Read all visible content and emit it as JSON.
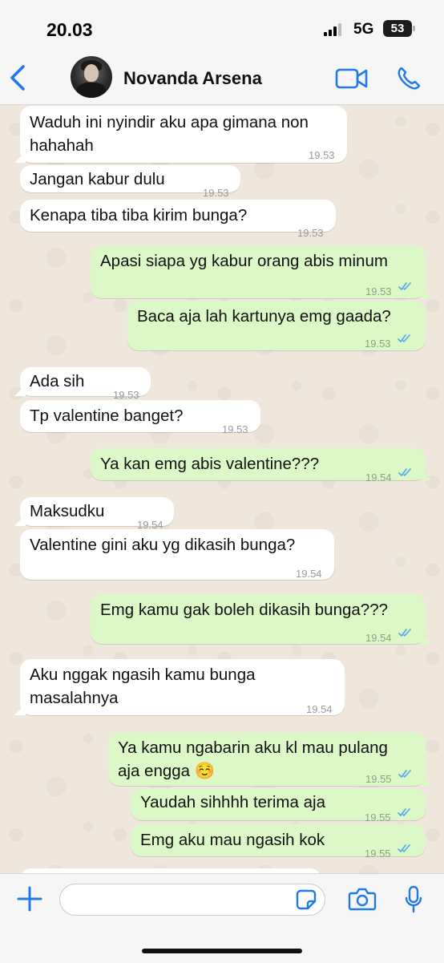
{
  "status_bar": {
    "time": "20.03",
    "network": "5G",
    "battery": "53"
  },
  "header": {
    "contact_name": "Novanda Arsena"
  },
  "messages": [
    {
      "dir": "in",
      "lines": [
        "Waduh ini nyindir aku apa gimana non",
        "hahahah"
      ],
      "time": "19.53"
    },
    {
      "dir": "in",
      "lines": [
        "Jangan kabur dulu"
      ],
      "time": "19.53"
    },
    {
      "dir": "in",
      "lines": [
        "Kenapa tiba tiba kirim bunga?"
      ],
      "time": "19.53"
    },
    {
      "dir": "out",
      "lines": [
        "Apasi siapa yg kabur orang abis minum"
      ],
      "time": "19.53",
      "read": true
    },
    {
      "dir": "out",
      "lines": [
        "Baca aja lah kartunya emg gaada?"
      ],
      "time": "19.53",
      "read": true
    },
    {
      "dir": "in",
      "lines": [
        "Ada sih"
      ],
      "time": "19.53"
    },
    {
      "dir": "in",
      "lines": [
        "Tp valentine banget?"
      ],
      "time": "19.53"
    },
    {
      "dir": "out",
      "lines": [
        "Ya kan emg abis valentine???"
      ],
      "time": "19.54",
      "read": true
    },
    {
      "dir": "in",
      "lines": [
        "Maksudku"
      ],
      "time": "19.54"
    },
    {
      "dir": "in",
      "lines": [
        "Valentine gini aku yg dikasih bunga?"
      ],
      "time": "19.54"
    },
    {
      "dir": "out",
      "lines": [
        "Emg kamu gak boleh dikasih bunga???"
      ],
      "time": "19.54",
      "read": true
    },
    {
      "dir": "in",
      "lines": [
        "Aku nggak ngasih kamu bunga",
        "masalahnya"
      ],
      "time": "19.54"
    },
    {
      "dir": "out",
      "lines": [
        "Ya kamu ngabarin aku kl mau pulang",
        "aja engga ☺️"
      ],
      "time": "19.55",
      "read": true
    },
    {
      "dir": "out",
      "lines": [
        "Yaudah sihhhh terima aja"
      ],
      "time": "19.55",
      "read": true
    },
    {
      "dir": "out",
      "lines": [
        "Emg aku mau ngasih kok"
      ],
      "time": "19.55",
      "read": true
    }
  ],
  "input": {
    "placeholder": ""
  },
  "icons": {
    "back": "chevron-left-icon",
    "video": "video-call-icon",
    "phone": "phone-call-icon",
    "plus": "plus-icon",
    "sticker": "sticker-icon",
    "camera": "camera-icon",
    "mic": "microphone-icon",
    "read": "double-check-icon"
  },
  "colors": {
    "accent": "#1f7ae6",
    "outgoing": "#dcf8c6",
    "incoming": "#ffffff",
    "read_ticks": "#4fa7ea"
  }
}
